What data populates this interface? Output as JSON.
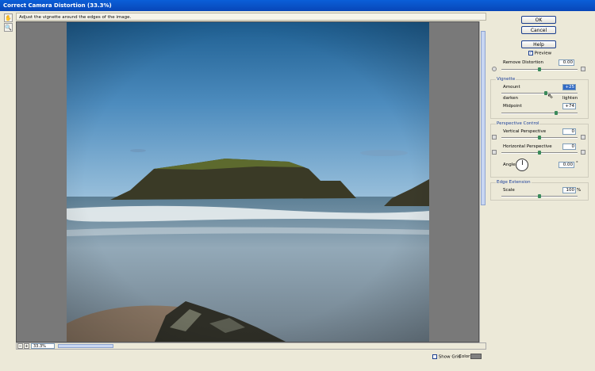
{
  "window": {
    "title": "Correct Camera Distortion (33.3%)"
  },
  "hint": "Adjust the vignette around the edges of the image.",
  "tools": [
    "hand-icon",
    "zoom-icon"
  ],
  "zoom": {
    "value": "33.3%"
  },
  "buttons": {
    "ok": "OK",
    "cancel": "Cancel",
    "help": "Help"
  },
  "preview": {
    "label": "Preview",
    "checked": true
  },
  "remove_distortion": {
    "label": "Remove Distortion",
    "value": "0.00"
  },
  "vignette": {
    "title": "Vignette",
    "amount_label": "Amount",
    "amount_value": "+25",
    "darken_label": "darken",
    "lighten_label": "lighten",
    "midpoint_label": "Midpoint",
    "midpoint_value": "+74"
  },
  "perspective": {
    "title": "Perspective Control",
    "vertical_label": "Vertical Perspective",
    "vertical_value": "0",
    "horizontal_label": "Horizontal Perspective",
    "horizontal_value": "0",
    "angle_label": "Angle:",
    "angle_value": "0.00",
    "angle_unit": "°"
  },
  "edge_extension": {
    "title": "Edge Extension",
    "scale_label": "Scale",
    "scale_value": "100",
    "scale_unit": "%"
  },
  "footer": {
    "show_grid_label": "Show Grid",
    "show_grid_checked": false,
    "color_label": "Color:",
    "grid_color": "#808080"
  },
  "colors": {
    "title_bar": "#0a5fd8",
    "group_title": "#1a3e9a",
    "slider_knob": "#3a8a5a"
  }
}
